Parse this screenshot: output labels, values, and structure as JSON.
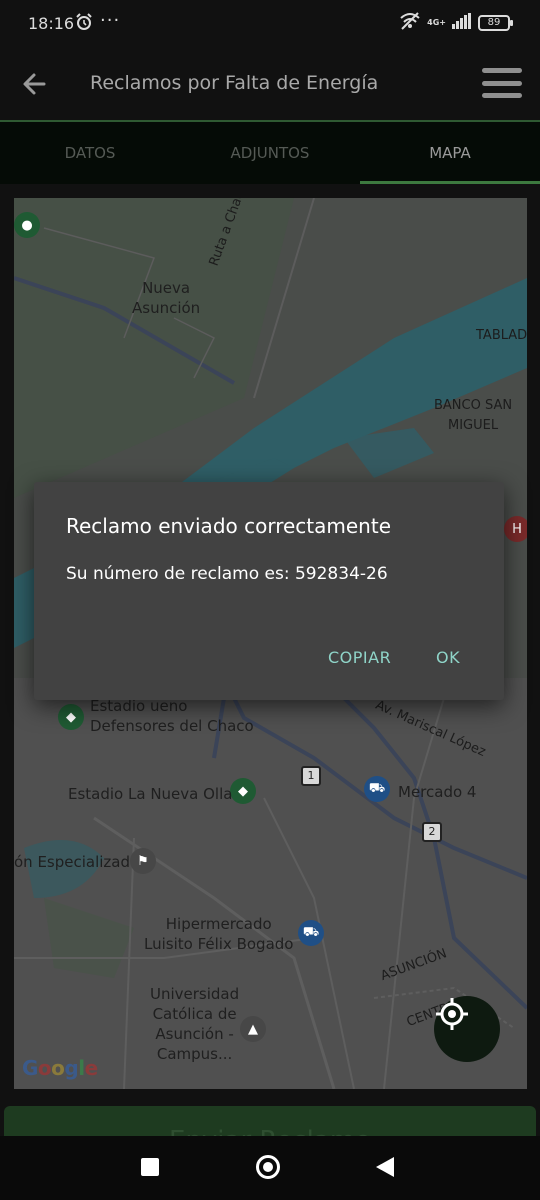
{
  "status_bar": {
    "time": "18:16",
    "network": "4G+",
    "battery": "89"
  },
  "app_bar": {
    "title": "Reclamos por Falta de Energía"
  },
  "tabs": [
    {
      "label": "DATOS",
      "active": false
    },
    {
      "label": "ADJUNTOS",
      "active": false
    },
    {
      "label": "MAPA",
      "active": true
    }
  ],
  "map": {
    "labels": {
      "nueva_asuncion": "Nueva\nAsunción",
      "ruta_chaco": "Ruta a Chaco'i",
      "tablada": "TABLAD",
      "banco_san_miguel": "BANCO SAN\nMIGUEL",
      "estadio_defensores": "Estadio ueno\nDefensores del Chaco",
      "mariscal_lopez": "Av. Mariscal López",
      "estadio_la_nueva_olla": "Estadio La Nueva Olla",
      "mercado_4": "Mercado 4",
      "especializada": "ón Especializada",
      "hipermercado": "Hipermercado\nLuisito Félix Bogado",
      "universidad": "Universidad\nCatólica de\nAsunción -\nCampus...",
      "asuncion": "ASUNCIÓN",
      "central": "CENTRAL",
      "route_1": "1",
      "route_2": "2"
    },
    "attribution": "Google",
    "icons": {
      "stadium": "stadium-icon",
      "shopping": "shopping-cart-icon",
      "police": "police-icon",
      "school": "school-icon",
      "hospital": "hospital-icon",
      "my_location": "my-location-icon"
    }
  },
  "dialog": {
    "title": "Reclamo enviado correctamente",
    "message": "Su número de reclamo es: 592834-26",
    "copy_label": "COPIAR",
    "ok_label": "OK"
  },
  "submit_button": {
    "label": "Enviar Reclamo"
  },
  "colors": {
    "accent_green": "#3d7a3f",
    "dialog_button": "#8fd4c8",
    "dialog_bg": "#424242"
  }
}
